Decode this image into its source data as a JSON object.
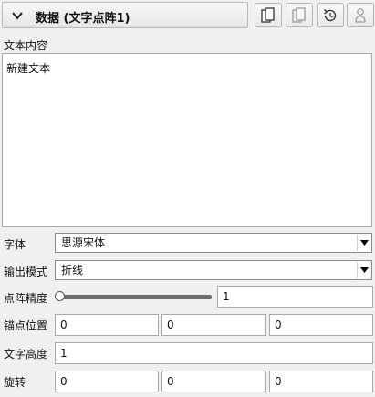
{
  "header": {
    "title": "数据 (文字点阵1)",
    "buttons": [
      "copy-icon",
      "paste-icon",
      "reset-icon",
      "user-icon"
    ]
  },
  "content": {
    "label": "文本内容",
    "text": "新建文本"
  },
  "font": {
    "label": "字体",
    "value": "思源宋体"
  },
  "output_mode": {
    "label": "输出模式",
    "value": "折线"
  },
  "precision": {
    "label": "点阵精度",
    "value": "1",
    "slider_fraction": 0.0
  },
  "anchor": {
    "label": "锚点位置",
    "values": [
      "0",
      "0",
      "0"
    ]
  },
  "text_height": {
    "label": "文字高度",
    "value": "1"
  },
  "rotation": {
    "label": "旋转",
    "values": [
      "0",
      "0",
      "0"
    ]
  }
}
